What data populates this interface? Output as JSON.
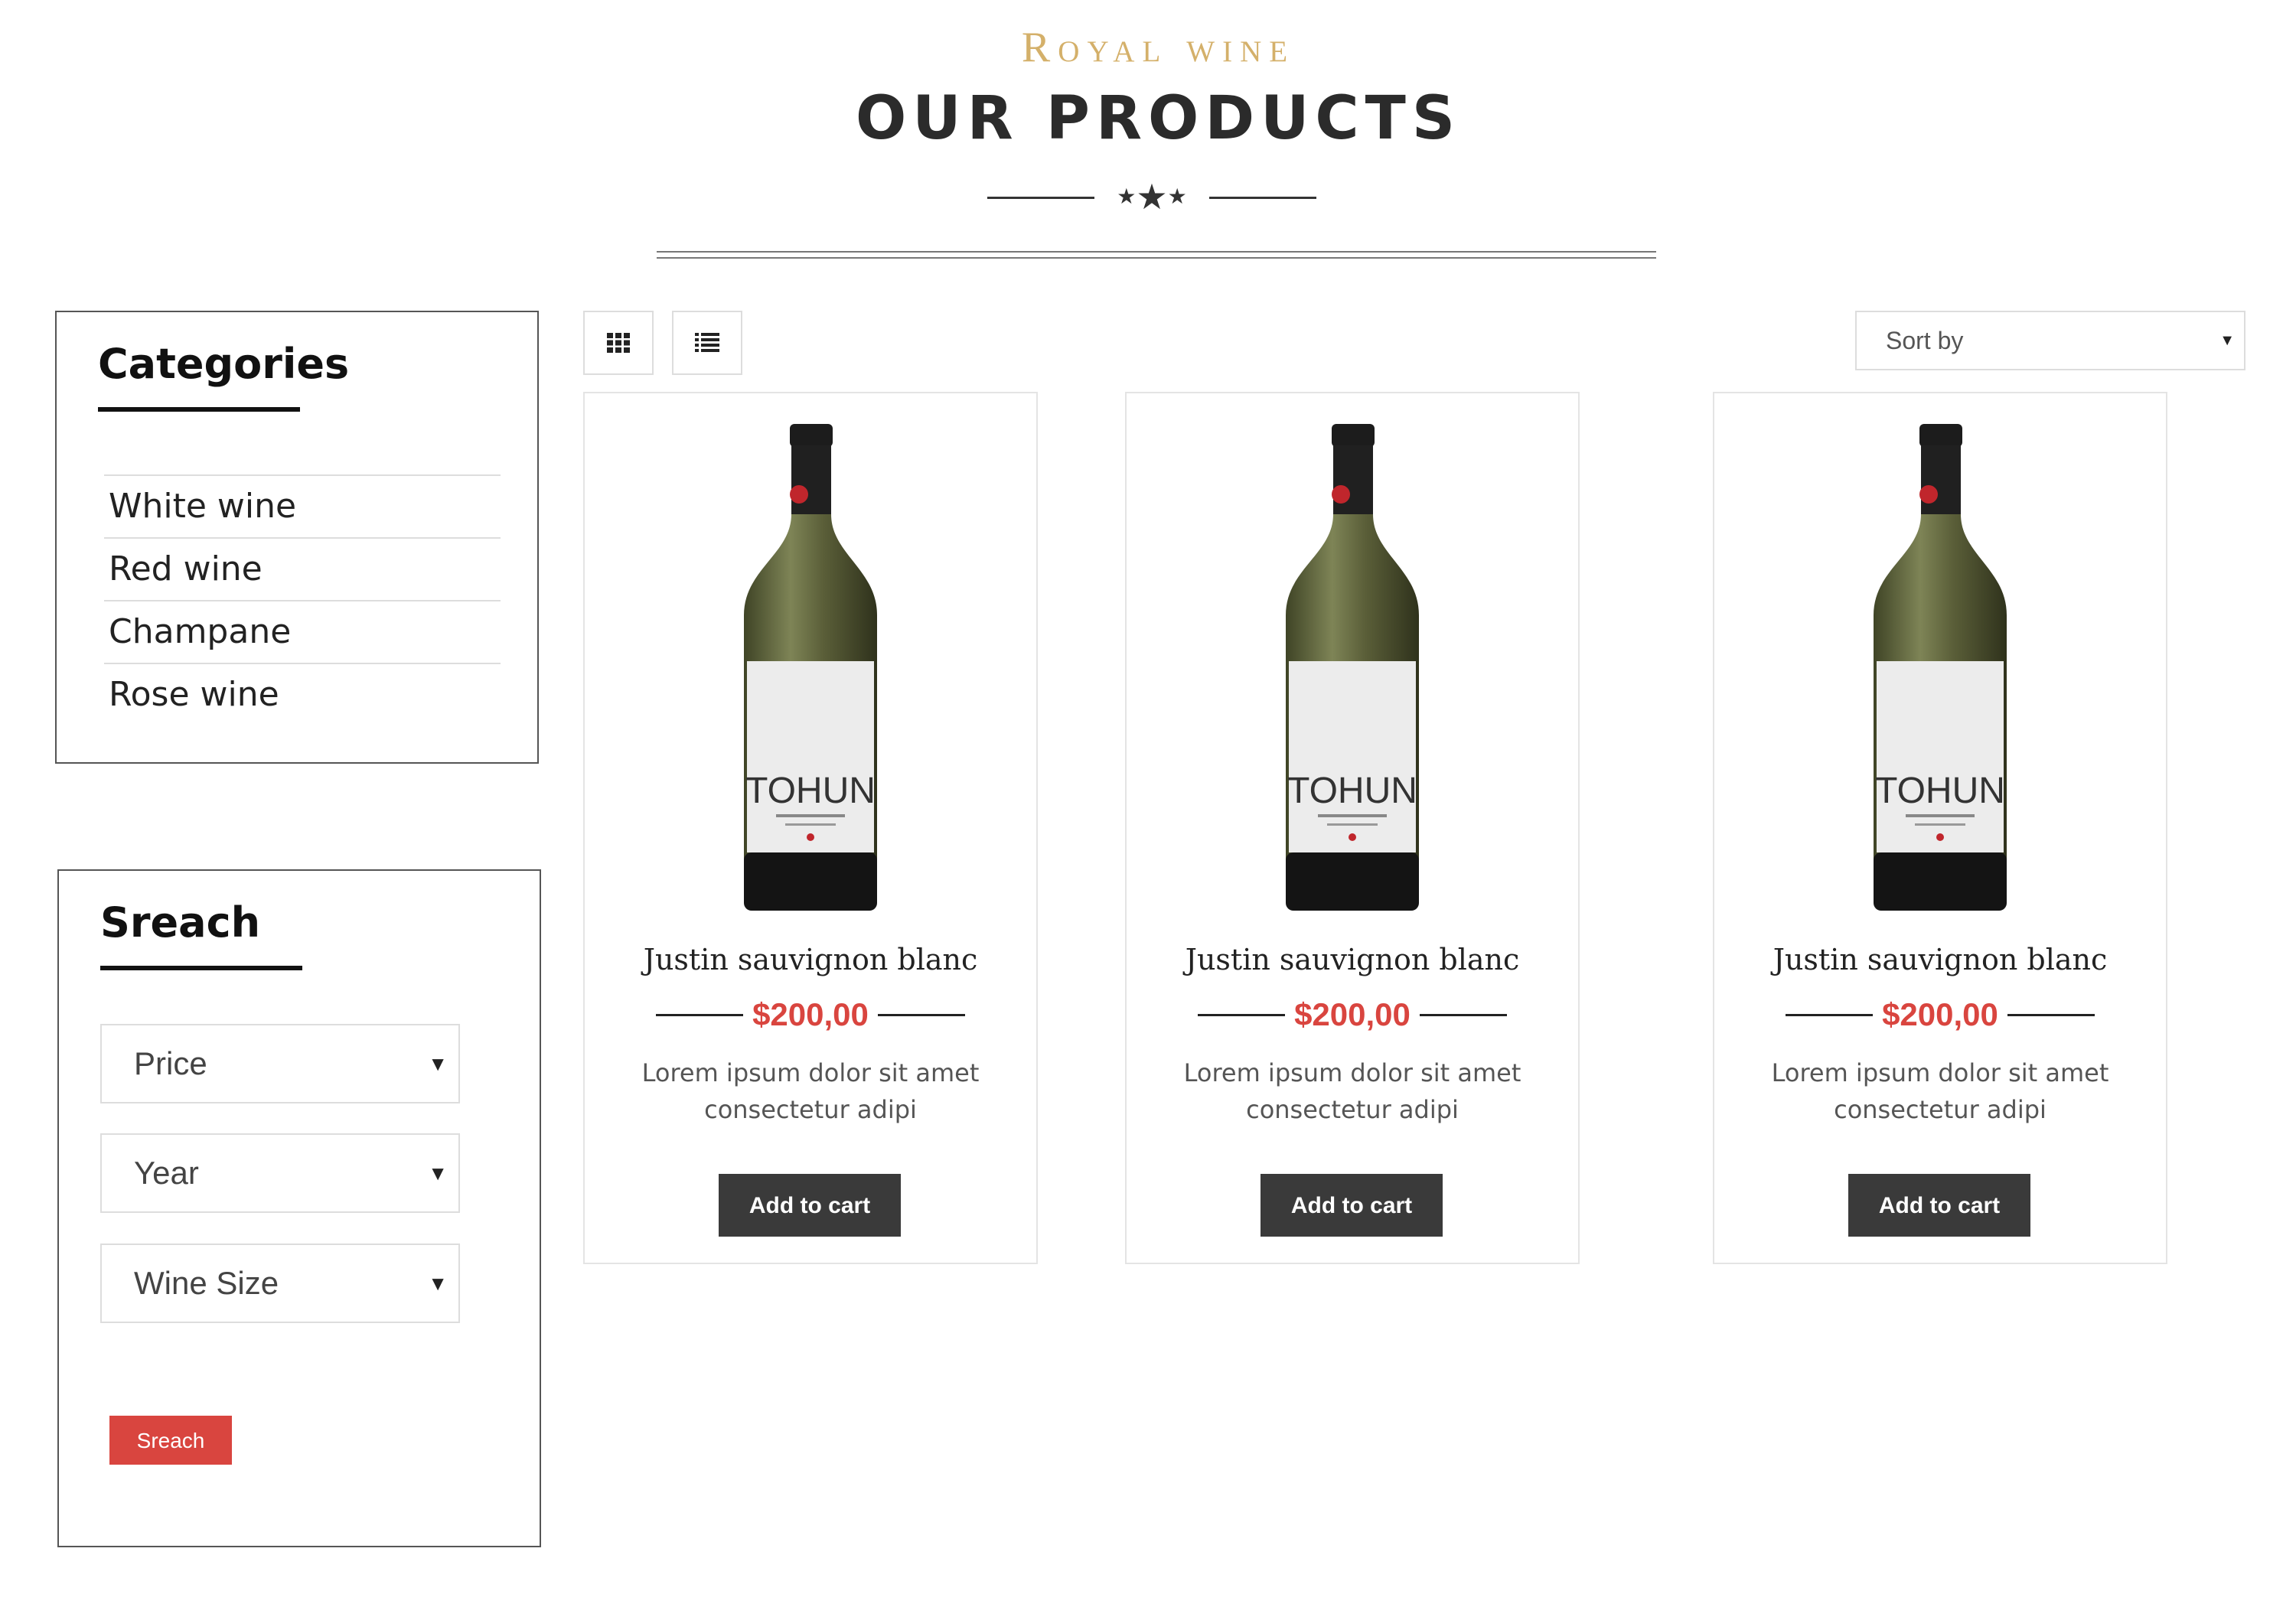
{
  "header": {
    "brand": "Royal wine",
    "title": "OUR PRODUCTS"
  },
  "categories": {
    "title": "Categories",
    "items": [
      "White wine",
      "Red wine",
      "Champane",
      "Rose wine"
    ]
  },
  "search": {
    "title": "Sreach",
    "filters": {
      "price": "Price",
      "year": "Year",
      "size": "Wine Size"
    },
    "button_label": "Sreach"
  },
  "toolbar": {
    "grid_icon": "grid-view-icon",
    "list_icon": "list-view-icon",
    "sort_label": "Sort by"
  },
  "products": [
    {
      "label_text": "TOHUN",
      "name": "Justin sauvignon blanc",
      "price": "$200,00",
      "description": "Lorem ipsum dolor sit amet consectetur adipi",
      "cart_label": "Add to cart"
    },
    {
      "label_text": "TOHUN",
      "name": "Justin sauvignon blanc",
      "price": "$200,00",
      "description": "Lorem ipsum dolor sit amet consectetur adipi",
      "cart_label": "Add to cart"
    },
    {
      "label_text": "TOHUN",
      "name": "Justin sauvignon blanc",
      "price": "$200,00",
      "description": "Lorem ipsum dolor sit amet consectetur adipi",
      "cart_label": "Add to cart"
    }
  ],
  "colors": {
    "brand_gold": "#d4b06a",
    "price_red": "#d9453f",
    "button_dark": "#3a3a3a"
  }
}
